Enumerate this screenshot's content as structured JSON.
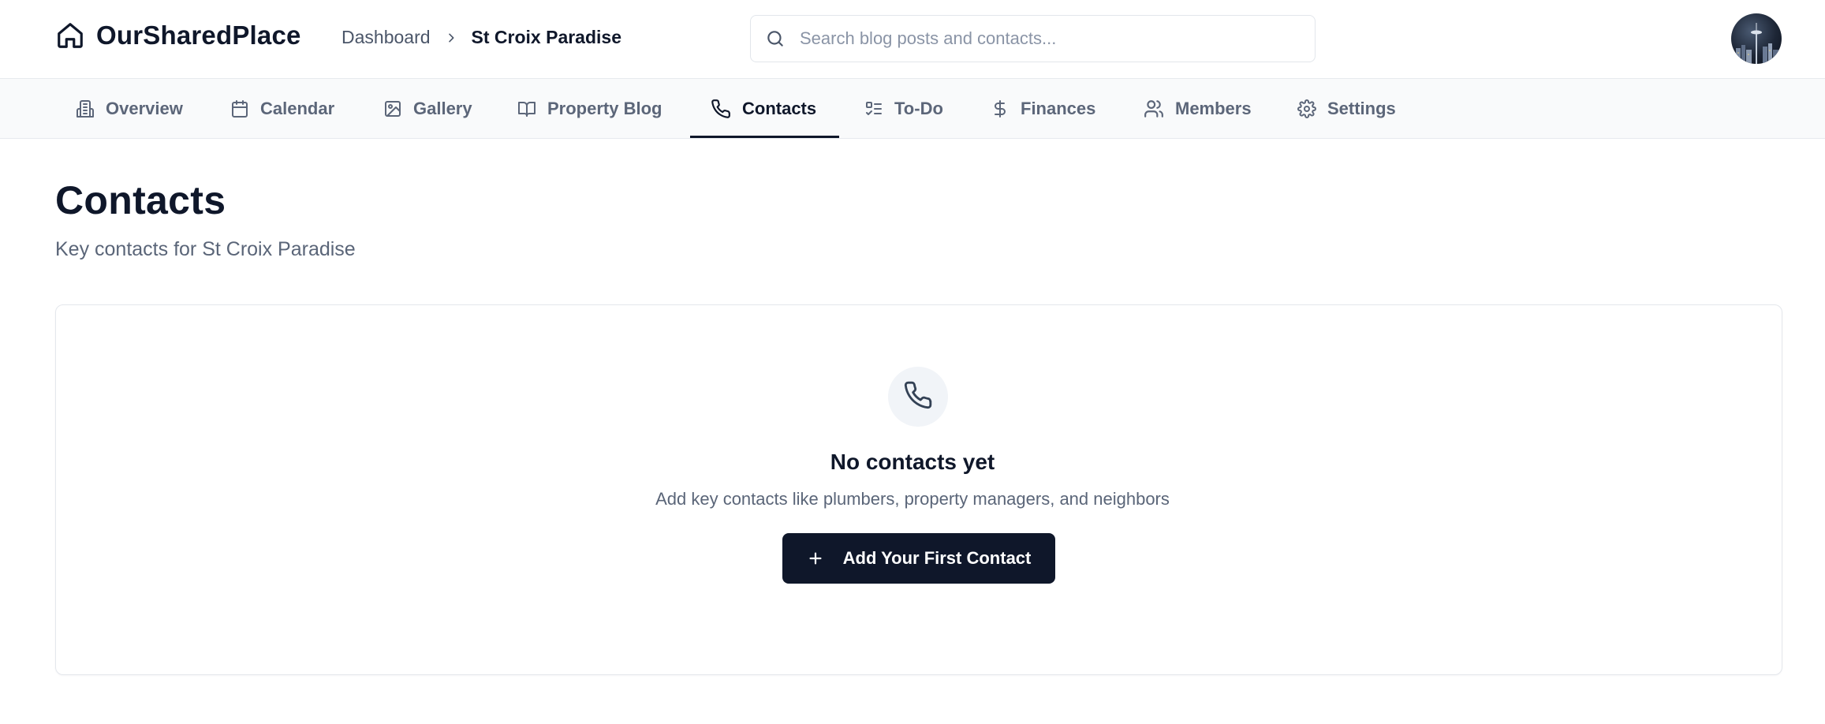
{
  "brand": {
    "name": "OurSharedPlace",
    "icon": "home-icon"
  },
  "breadcrumb": {
    "parent": "Dashboard",
    "separator_icon": "chevron-right-icon",
    "current": "St Croix Paradise"
  },
  "search": {
    "placeholder": "Search blog posts and contacts...",
    "value": "",
    "icon": "search-icon"
  },
  "user": {
    "avatar": "user-avatar-photo"
  },
  "tabs": [
    {
      "label": "Overview",
      "icon": "building-icon",
      "active": false
    },
    {
      "label": "Calendar",
      "icon": "calendar-icon",
      "active": false
    },
    {
      "label": "Gallery",
      "icon": "image-icon",
      "active": false
    },
    {
      "label": "Property Blog",
      "icon": "book-open-icon",
      "active": false
    },
    {
      "label": "Contacts",
      "icon": "phone-icon",
      "active": true
    },
    {
      "label": "To-Do",
      "icon": "list-todo-icon",
      "active": false
    },
    {
      "label": "Finances",
      "icon": "dollar-icon",
      "active": false
    },
    {
      "label": "Members",
      "icon": "users-icon",
      "active": false
    },
    {
      "label": "Settings",
      "icon": "gear-icon",
      "active": false
    }
  ],
  "page": {
    "title": "Contacts",
    "subtitle": "Key contacts for St Croix Paradise"
  },
  "empty_state": {
    "icon": "phone-icon",
    "title": "No contacts yet",
    "description": "Add key contacts like plumbers, property managers, and neighbors",
    "button_label": "Add Your First Contact",
    "button_icon": "plus-icon"
  },
  "colors": {
    "primary": "#0f172a",
    "muted_text": "#5a6578",
    "tab_bar_bg": "#f9fafb",
    "border": "#e7eaee"
  }
}
